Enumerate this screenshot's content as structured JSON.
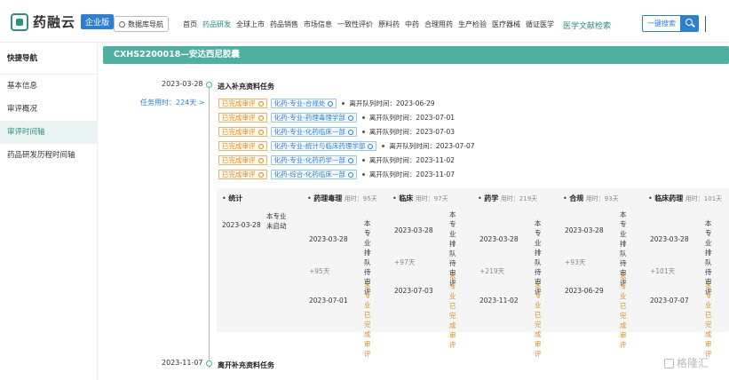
{
  "topbar": {
    "logo_text": "药融云",
    "badge": "企业版",
    "db_nav": "数据库导航",
    "menu": [
      "首页",
      "药品研发",
      "全球上市",
      "药品销售",
      "市场信息",
      "一致性评价",
      "原料药",
      "中药",
      "合理用药",
      "生产检验",
      "医疗器械",
      "循证医学"
    ],
    "menu_active_index": 1,
    "literature": "医学文献检索",
    "search_btn": "一键搜索"
  },
  "sidebar": {
    "title": "快捷导航",
    "items": [
      "基本信息",
      "审评概况",
      "审评时间轴",
      "药品研发历程时间轴"
    ],
    "active_index": 2
  },
  "header": {
    "title": "CXHS2200018—安达西尼胶囊"
  },
  "timeline": {
    "event1": {
      "date": "2023-03-28",
      "label": "进入补充资料任务",
      "duration": "任务用时：224天 >"
    },
    "tasks": [
      {
        "status": "已完成审评",
        "dept": "化药-专业-合规处",
        "leave": "离开队列时间：2023-06-29"
      },
      {
        "status": "已完成审评",
        "dept": "化药-专业-药理毒理学部",
        "leave": "离开队列时间：2023-07-01"
      },
      {
        "status": "已完成审评",
        "dept": "化药-专业-化药临床一部",
        "leave": "离开队列时间：2023-07-03"
      },
      {
        "status": "已完成审评",
        "dept": "化药-专业-统计与临床药理学部",
        "leave": "离开队列时间：2023-07-07"
      },
      {
        "status": "已完成审评",
        "dept": "化药-专业-化药药学一部",
        "leave": "离开队列时间：2023-11-02"
      },
      {
        "status": "已完成审评",
        "dept": "化药-综合-化药临床一部",
        "leave": "离开队列时间：2023-11-07"
      }
    ],
    "event2": {
      "date": "2023-11-07",
      "label": "离开补充资料任务"
    }
  },
  "panel": {
    "columns": [
      {
        "name": "统计",
        "time": "",
        "start": "2023-03-28",
        "start_status": "本专业未启动",
        "plus": "",
        "end": "",
        "end_status": ""
      },
      {
        "name": "药理毒理",
        "time": "用时：95天",
        "start": "2023-03-28",
        "start_status": "本专业排队待审评",
        "plus": "+95天",
        "end": "2023-07-01",
        "end_status": "本专业已完成审评"
      },
      {
        "name": "临床",
        "time": "用时：97天",
        "start": "2023-03-28",
        "start_status": "本专业排队待审评",
        "plus": "+97天",
        "end": "2023-07-03",
        "end_status": "本专业已完成审评"
      },
      {
        "name": "药学",
        "time": "用时：219天",
        "start": "2023-03-28",
        "start_status": "本专业排队待审评",
        "plus": "+219天",
        "end": "2023-11-02",
        "end_status": "本专业已完成审评"
      },
      {
        "name": "合规",
        "time": "用时：93天",
        "start": "2023-03-28",
        "start_status": "本专业排队待审评",
        "plus": "+93天",
        "end": "2023-06-29",
        "end_status": "本专业已完成审评"
      },
      {
        "name": "临床药理",
        "time": "用时：101天",
        "start": "2023-03-28",
        "start_status": "本专业排队待审评",
        "plus": "+101天",
        "end": "2023-07-07",
        "end_status": "本专业已完成审评"
      }
    ]
  },
  "watermark": "格隆汇",
  "colors": {
    "accent": "#4fb0a2",
    "link": "#2f7fd1",
    "done": "#d98a1f"
  }
}
